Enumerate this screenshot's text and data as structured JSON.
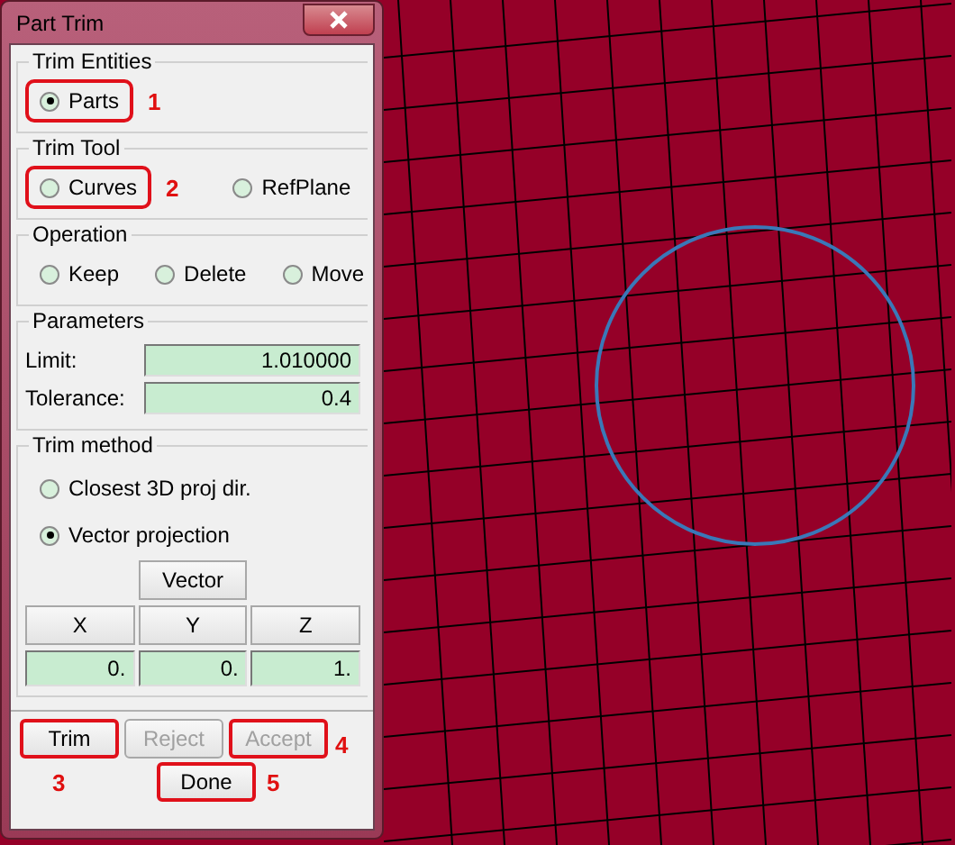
{
  "window": {
    "title": "Part Trim"
  },
  "trim_entities": {
    "title": "Trim Entities",
    "options": [
      {
        "label": "Parts",
        "selected": true,
        "annotation": "1"
      }
    ]
  },
  "trim_tool": {
    "title": "Trim Tool",
    "options": [
      {
        "label": "Curves",
        "selected": false,
        "annotation": "2"
      },
      {
        "label": "RefPlane",
        "selected": false
      }
    ]
  },
  "operation": {
    "title": "Operation",
    "options": [
      {
        "label": "Keep",
        "selected": false
      },
      {
        "label": "Delete",
        "selected": false
      },
      {
        "label": "Move",
        "selected": false
      }
    ]
  },
  "parameters": {
    "title": "Parameters",
    "fields": [
      {
        "label": "Limit:",
        "value": "1.010000"
      },
      {
        "label": "Tolerance:",
        "value": "0.4"
      }
    ]
  },
  "trim_method": {
    "title": "Trim method",
    "options": [
      {
        "label": "Closest 3D proj dir.",
        "selected": false
      },
      {
        "label": "Vector projection",
        "selected": true
      }
    ],
    "vector_button": "Vector",
    "axes": [
      {
        "label": "X",
        "value": "0."
      },
      {
        "label": "Y",
        "value": "0."
      },
      {
        "label": "Z",
        "value": "1."
      }
    ]
  },
  "actions": [
    {
      "label": "Trim",
      "disabled": false,
      "annotation": "3"
    },
    {
      "label": "Reject",
      "disabled": true
    },
    {
      "label": "Accept",
      "disabled": true,
      "annotation": "4"
    }
  ],
  "done": {
    "label": "Done",
    "disabled": false,
    "annotation": "5"
  }
}
